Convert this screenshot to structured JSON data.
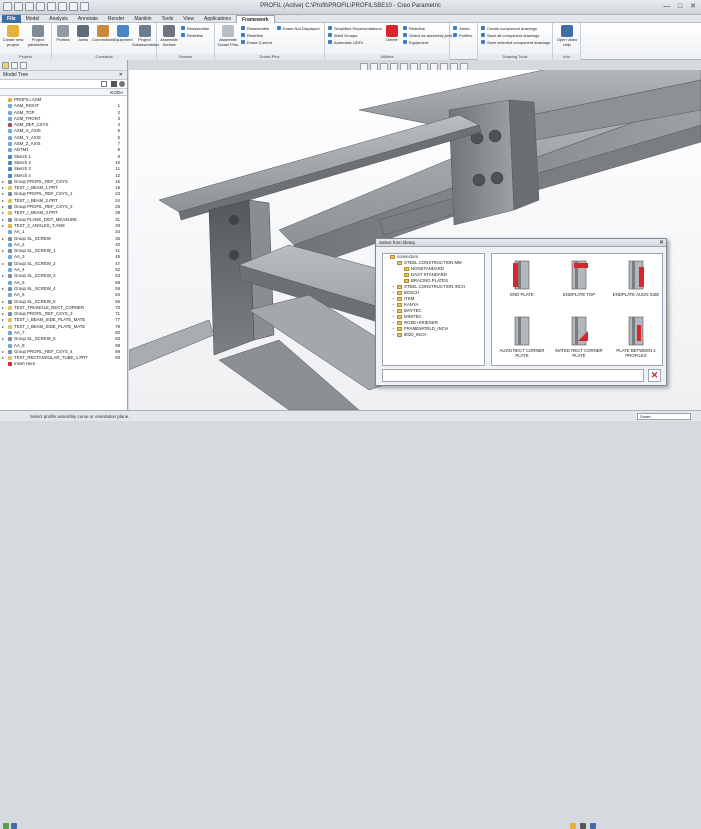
{
  "window": {
    "title": "PROFIL (Active) C:\\Profil\\PROFIL\\PROFILSBE10 - Creo Parametric",
    "controls": [
      "—",
      "□",
      "✕"
    ]
  },
  "menu": {
    "tabs": [
      "File",
      "Model",
      "Analysis",
      "Annotate",
      "Render",
      "Manikin",
      "Tools",
      "View",
      "Applications",
      "Framework"
    ],
    "active": "Framework"
  },
  "ribbon": {
    "groups": [
      {
        "label": "Project",
        "buttons": [
          "Create new project",
          "Project parameters"
        ]
      },
      {
        "label": "Construct",
        "buttons": [
          "Profiles",
          "Joints",
          "Connections",
          "Equipment",
          "Project Subassemblies"
        ]
      },
      {
        "label": "Screws",
        "buttons": [
          "Assemble Screws"
        ],
        "small": [
          "Reassemble",
          "Redefine"
        ]
      },
      {
        "label": "Dowel Pins",
        "buttons": [
          "Assemble Dowel Pins"
        ],
        "small": [
          "Reassemble",
          "Redefine",
          "Erase Current"
        ]
      },
      {
        "label": "",
        "small": [
          "Erase Not Displayed"
        ]
      },
      {
        "label": "Utilities",
        "small": [
          "Simplified Representations",
          "Weld Groups",
          "Automatic UDFs"
        ],
        "buttons": [
          "Delete"
        ],
        "small2": [
          "Redefine",
          "Select as assembly joint",
          "Equipment"
        ]
      },
      {
        "label": "",
        "small": [
          "Joints",
          "Profiles"
        ]
      },
      {
        "label": "Drawing Tools",
        "small": [
          "Create component drawings",
          "Save all component drawings",
          "Save selected component drawings"
        ]
      },
      {
        "label": "Info",
        "buttons": [
          "Open video help"
        ]
      }
    ]
  },
  "model_tree": {
    "title": "Model Tree",
    "column": "KODA",
    "rows": [
      {
        "name": "PROFILI.ASM",
        "code": "",
        "icon": "asm"
      },
      {
        "name": "ASM_RIGHT",
        "code": "1",
        "icon": "plane"
      },
      {
        "name": "ASM_TOP",
        "code": "2",
        "icon": "plane"
      },
      {
        "name": "ASM_FRONT",
        "code": "3",
        "icon": "plane"
      },
      {
        "name": "ASM_DEF_CSYS",
        "code": "4",
        "icon": "csys"
      },
      {
        "name": "ASM_X_AXIS",
        "code": "5",
        "icon": "axis"
      },
      {
        "name": "ASM_Y_AXIS",
        "code": "6",
        "icon": "axis"
      },
      {
        "name": "ASM_Z_AXIS",
        "code": "7",
        "icon": "axis"
      },
      {
        "name": "ADTM1",
        "code": "8",
        "icon": "plane"
      },
      {
        "name": "Sketch 1",
        "code": "9",
        "icon": "sketch"
      },
      {
        "name": "Sketch 2",
        "code": "10",
        "icon": "sketch"
      },
      {
        "name": "Sketch 3",
        "code": "11",
        "icon": "sketch"
      },
      {
        "name": "Sketch 4",
        "code": "12",
        "icon": "sketch"
      },
      {
        "name": "Group PROFIL_REF_CSYS",
        "code": "15",
        "icon": "group",
        "exp": true
      },
      {
        "name": "TEST_I_BEAM_1.PRT",
        "code": "19",
        "icon": "part",
        "exp": true
      },
      {
        "name": "Group PROFIL_REF_CSYS_1",
        "code": "23",
        "icon": "group",
        "exp": true
      },
      {
        "name": "TEST_I_BEAM_2.PRT",
        "code": "24",
        "icon": "part",
        "exp": true
      },
      {
        "name": "Group PROFIL_REF_CSYS_2",
        "code": "26",
        "icon": "group",
        "exp": true
      },
      {
        "name": "TEST_I_BEAM_3.PRT",
        "code": "28",
        "icon": "part",
        "exp": true
      },
      {
        "name": "Group PLANE_DIST_MEASURE",
        "code": "31",
        "icon": "group",
        "exp": true
      },
      {
        "name": "TEST_2_ANGLES_T.ASM",
        "code": "33",
        "icon": "asm",
        "exp": true
      },
      {
        "name": "AA_1",
        "code": "34",
        "icon": "axis"
      },
      {
        "name": "Group SL_SCREW",
        "code": "35",
        "icon": "group",
        "exp": true
      },
      {
        "name": "AA_2",
        "code": "40",
        "icon": "axis"
      },
      {
        "name": "Group SL_SCREW_1",
        "code": "41",
        "icon": "group",
        "exp": true
      },
      {
        "name": "AA_3",
        "code": "45",
        "icon": "axis"
      },
      {
        "name": "Group SL_SCREW_2",
        "code": "47",
        "icon": "group",
        "exp": true
      },
      {
        "name": "AA_4",
        "code": "52",
        "icon": "axis"
      },
      {
        "name": "Group SL_SCREW_3",
        "code": "53",
        "icon": "group",
        "exp": true
      },
      {
        "name": "AA_5",
        "code": "58",
        "icon": "axis"
      },
      {
        "name": "Group SL_SCREW_4",
        "code": "59",
        "icon": "group",
        "exp": true
      },
      {
        "name": "AA_6",
        "code": "64",
        "icon": "axis"
      },
      {
        "name": "Group SL_SCREW_5",
        "code": "65",
        "icon": "group",
        "exp": true
      },
      {
        "name": "TEST_TRIANGLE_RECT_CORNER",
        "code": "70",
        "icon": "part",
        "exp": true
      },
      {
        "name": "Group PROFIL_REF_CSYS_3",
        "code": "71",
        "icon": "group",
        "exp": true
      },
      {
        "name": "TEST_I_BEAM_SIDE_PLATE_MATE",
        "code": "77",
        "icon": "part",
        "exp": true
      },
      {
        "name": "TEST_I_BEAM_SIDE_PLATE_MATE",
        "code": "78",
        "icon": "part",
        "exp": true
      },
      {
        "name": "AA_7",
        "code": "82",
        "icon": "axis"
      },
      {
        "name": "Group SL_SCREW_6",
        "code": "83",
        "icon": "group",
        "exp": true
      },
      {
        "name": "AA_8",
        "code": "88",
        "icon": "axis"
      },
      {
        "name": "Group PROFIL_REF_CSYS_4",
        "code": "89",
        "icon": "group",
        "exp": true
      },
      {
        "name": "TEST_RECTANGULAR_TUBE_1.PRT",
        "code": "93",
        "icon": "part",
        "exp": true
      },
      {
        "name": "Insert Here",
        "code": "",
        "icon": "insert"
      }
    ]
  },
  "status": {
    "message": "Select profile assembly curve or orientation plane.",
    "filter": "Smart"
  },
  "dialog": {
    "title": "Select from library",
    "tree": [
      {
        "label": "connectors",
        "level": 0,
        "exp": "-"
      },
      {
        "label": "STEEL CONSTRUCTION MM",
        "level": 1,
        "exp": "-"
      },
      {
        "label": "NONSTANDARD",
        "level": 2,
        "exp": ""
      },
      {
        "label": "DAST STANDARD",
        "level": 2,
        "exp": ""
      },
      {
        "label": "BRACING PLATES",
        "level": 2,
        "exp": ""
      },
      {
        "label": "STEEL CONSTRUCTION INCH",
        "level": 1,
        "exp": "+"
      },
      {
        "label": "BOSCH",
        "level": 1,
        "exp": "+"
      },
      {
        "label": "ITEM",
        "level": 1,
        "exp": "+"
      },
      {
        "label": "KANYA",
        "level": 1,
        "exp": "+"
      },
      {
        "label": "MAYTEC",
        "level": 1,
        "exp": "+"
      },
      {
        "label": "MINITEC",
        "level": 1,
        "exp": "+"
      },
      {
        "label": "ROSE+KRIEGER",
        "level": 1,
        "exp": "+"
      },
      {
        "label": "FRAMEWORLD_INCH",
        "level": 1,
        "exp": "+"
      },
      {
        "label": "8020_INCH",
        "level": 1,
        "exp": "+"
      }
    ],
    "items": [
      {
        "label": "END PLATE",
        "hl": "left"
      },
      {
        "label": "ENDPLATE TOP",
        "hl": "top"
      },
      {
        "label": "ENDPLATE AUGN SIZE",
        "hl": "side"
      },
      {
        "label": "AUGN RECT CORNER PLATE",
        "hl": "none"
      },
      {
        "label": "MATED RECT CORNER PLATE",
        "hl": "corner"
      },
      {
        "label": "PLATE BETWEEN 2 PROFILES",
        "hl": "mid"
      }
    ]
  },
  "colors": {
    "accent": "#3f6ea6",
    "highlight": "#d9262e",
    "steel": "#9ea3a8"
  }
}
